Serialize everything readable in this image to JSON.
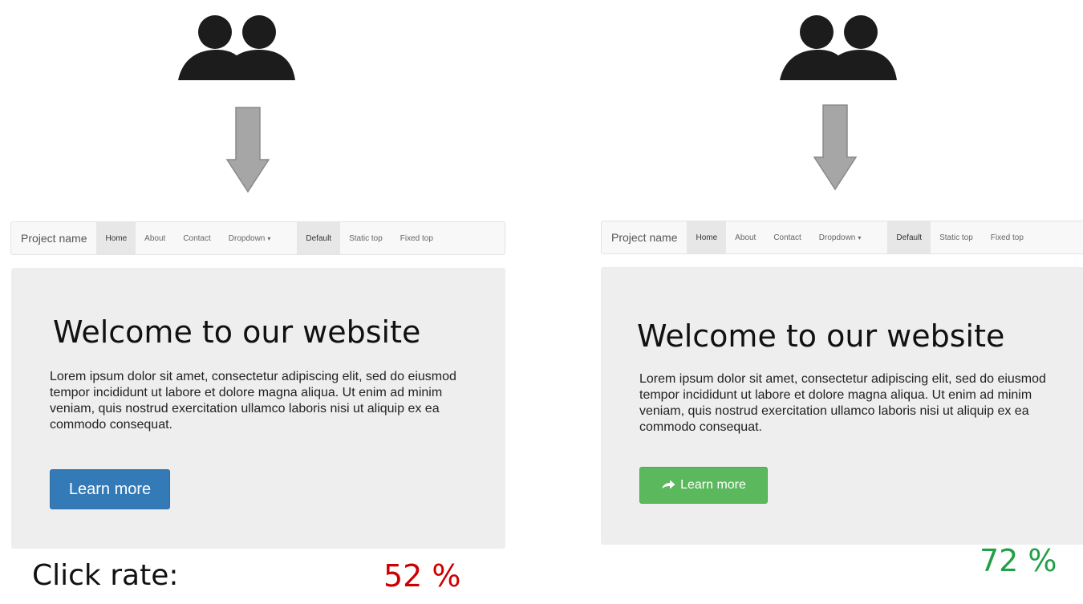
{
  "variant_a": {
    "navbar": {
      "brand": "Project name",
      "items": [
        "Home",
        "About",
        "Contact",
        "Dropdown"
      ],
      "right_items": [
        "Default",
        "Static top",
        "Fixed top"
      ]
    },
    "heading": "Welcome to our website",
    "body": "Lorem ipsum dolor sit amet, consectetur adipiscing elit, sed do eiusmod tempor incididunt ut labore et dolore magna aliqua. Ut enim ad minim veniam, quis nostrud exercitation ullamco laboris nisi ut aliquip ex ea commodo consequat.",
    "button_label": "Learn more",
    "button_color": "#337ab7",
    "click_rate": "52 %",
    "click_rate_color": "#cc0000"
  },
  "variant_b": {
    "navbar": {
      "brand": "Project name",
      "items": [
        "Home",
        "About",
        "Contact",
        "Dropdown"
      ],
      "right_items": [
        "Default",
        "Static top",
        "Fixed top"
      ]
    },
    "heading": "Welcome to our website",
    "body": "Lorem ipsum dolor sit amet, consectetur adipiscing elit, sed do eiusmod tempor incididunt ut labore et dolore magna aliqua. Ut enim ad minim veniam, quis nostrud exercitation ullamco laboris nisi ut aliquip ex ea commodo consequat.",
    "button_label": "Learn more",
    "button_icon": "arrow-right-icon",
    "button_color": "#5cb85c",
    "click_rate": "72 %",
    "click_rate_color": "#22a046"
  },
  "click_rate_label": "Click rate:",
  "icons": [
    "users-icon",
    "arrow-down-icon"
  ]
}
